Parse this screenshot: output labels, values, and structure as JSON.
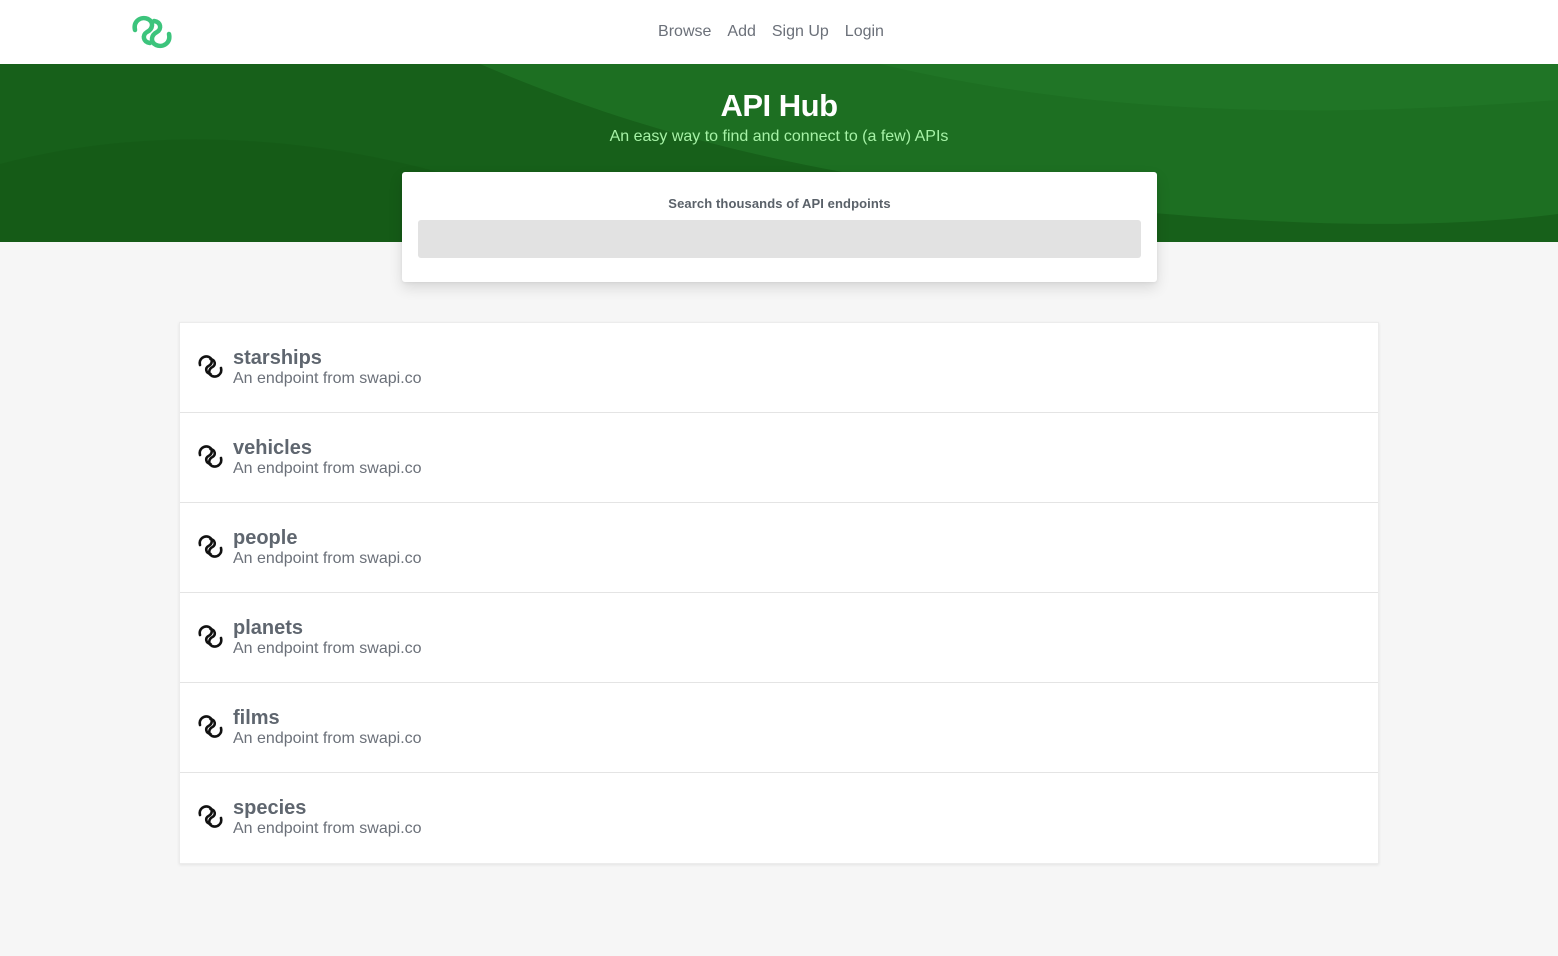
{
  "nav": {
    "logo_icon": "chain-link-logo-icon",
    "items": [
      {
        "label": "Browse"
      },
      {
        "label": "Add"
      },
      {
        "label": "Sign Up"
      },
      {
        "label": "Login"
      }
    ]
  },
  "hero": {
    "title": "API Hub",
    "subtitle": "An easy way to find and connect to (a few) APIs",
    "colors": {
      "background": "#17601a",
      "subtitle": "#a6f2a6",
      "logo": "#3cc47c"
    }
  },
  "search": {
    "label": "Search thousands of API endpoints",
    "value": "",
    "placeholder": ""
  },
  "endpoints": [
    {
      "name": "starships",
      "description": "An endpoint from swapi.co",
      "icon": "chain-link-icon"
    },
    {
      "name": "vehicles",
      "description": "An endpoint from swapi.co",
      "icon": "chain-link-icon"
    },
    {
      "name": "people",
      "description": "An endpoint from swapi.co",
      "icon": "chain-link-icon"
    },
    {
      "name": "planets",
      "description": "An endpoint from swapi.co",
      "icon": "chain-link-icon"
    },
    {
      "name": "films",
      "description": "An endpoint from swapi.co",
      "icon": "chain-link-icon"
    },
    {
      "name": "species",
      "description": "An endpoint from swapi.co",
      "icon": "chain-link-icon"
    }
  ]
}
